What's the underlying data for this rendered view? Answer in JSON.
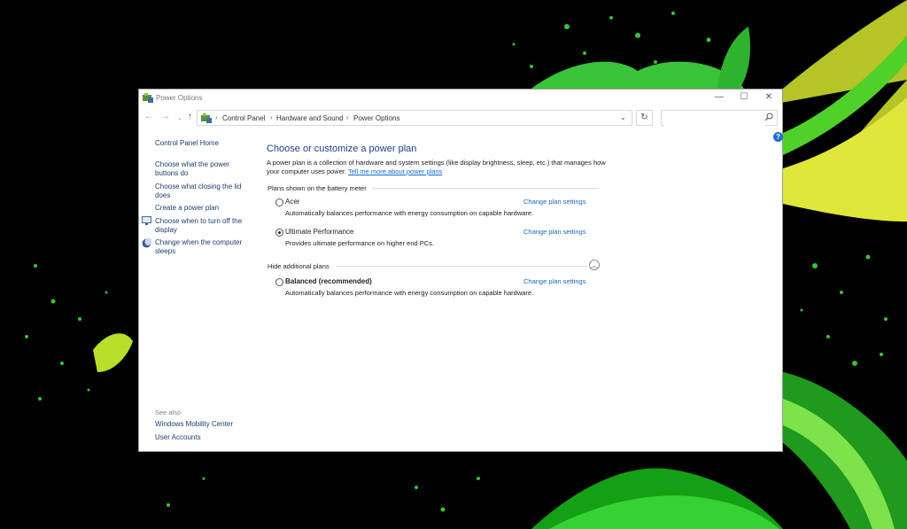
{
  "window": {
    "title": "Power Options",
    "controls": {
      "minimize": "—",
      "maximize": "☐",
      "close": "✕"
    }
  },
  "navigation": {
    "back": "←",
    "forward": "→",
    "recent": "⌄",
    "up": "↑",
    "breadcrumb": [
      "Control Panel",
      "Hardware and Sound",
      "Power Options"
    ],
    "separator": "›",
    "dropdown": "⌄",
    "refresh": "↻",
    "search_placeholder": ""
  },
  "help": "?",
  "sidebar": {
    "home": "Control Panel Home",
    "items": [
      {
        "label": "Choose what the power buttons do",
        "icon": "none"
      },
      {
        "label": "Choose what closing the lid does",
        "icon": "none"
      },
      {
        "label": "Create a power plan",
        "icon": "none"
      },
      {
        "label": "Choose when to turn off the display",
        "icon": "monitor-icon"
      },
      {
        "label": "Change when the computer sleeps",
        "icon": "moon-icon"
      }
    ],
    "see_also_label": "See also",
    "see_also": [
      "Windows Mobility Center",
      "User Accounts"
    ]
  },
  "main": {
    "heading": "Choose or customize a power plan",
    "description": "A power plan is a collection of hardware and system settings (like display brightness, sleep, etc.) that manages how your computer uses power.",
    "description_link": "Tell me more about power plans",
    "battery_group": "Plans shown on the battery meter",
    "additional_group": "Hide additional plans",
    "plans": [
      {
        "name": "Acer",
        "description": "Automatically balances performance with energy consumption on capable hardware.",
        "link": "Change plan settings",
        "selected": false
      },
      {
        "name": "Ultimate Performance",
        "description": "Provides ultimate performance on higher end PCs.",
        "link": "Change plan settings",
        "selected": true
      },
      {
        "name": "Balanced (recommended)",
        "description": "Automatically balances performance with energy consumption on capable hardware.",
        "link": "Change plan settings",
        "selected": false
      }
    ]
  },
  "colors": {
    "accent_link": "#1a64c8",
    "heading": "#1e3f8a",
    "wallpaper_green": "#2bd12b",
    "wallpaper_yellow": "#d9e32a"
  }
}
